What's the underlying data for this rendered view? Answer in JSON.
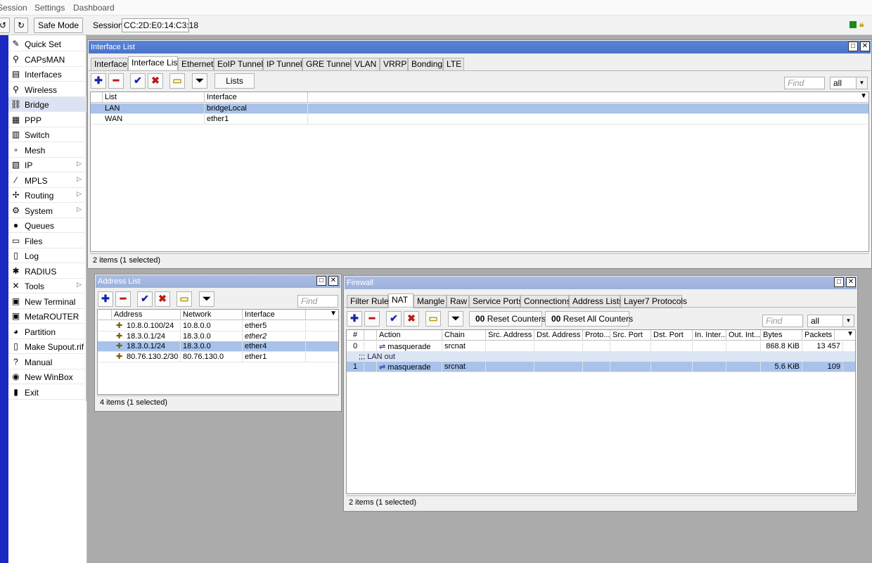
{
  "menu": {
    "session": "Session",
    "settings": "Settings",
    "dashboard": "Dashboard"
  },
  "toolbar": {
    "undo": "↺",
    "redo": "↻",
    "safe_mode": "Safe Mode",
    "session_label": "Session:",
    "session_value": "CC:2D:E0:14:C3:18"
  },
  "sidebar": {
    "items": [
      {
        "label": "Quick Set",
        "icon": "✎"
      },
      {
        "label": "CAPsMAN",
        "icon": "⚲"
      },
      {
        "label": "Interfaces",
        "icon": "▤"
      },
      {
        "label": "Wireless",
        "icon": "⚲"
      },
      {
        "label": "Bridge",
        "icon": "⛓"
      },
      {
        "label": "PPP",
        "icon": "▦"
      },
      {
        "label": "Switch",
        "icon": "▥"
      },
      {
        "label": "Mesh",
        "icon": "∘"
      },
      {
        "label": "IP",
        "icon": "▧",
        "arrow": "▷"
      },
      {
        "label": "MPLS",
        "icon": "⁄",
        "arrow": "▷"
      },
      {
        "label": "Routing",
        "icon": "✢",
        "arrow": "▷"
      },
      {
        "label": "System",
        "icon": "⚙",
        "arrow": "▷"
      },
      {
        "label": "Queues",
        "icon": "●"
      },
      {
        "label": "Files",
        "icon": "▭"
      },
      {
        "label": "Log",
        "icon": "▯"
      },
      {
        "label": "RADIUS",
        "icon": "✱"
      },
      {
        "label": "Tools",
        "icon": "✕",
        "arrow": "▷"
      },
      {
        "label": "New Terminal",
        "icon": "▣"
      },
      {
        "label": "MetaROUTER",
        "icon": "▣"
      },
      {
        "label": "Partition",
        "icon": "◕"
      },
      {
        "label": "Make Supout.rif",
        "icon": "▯"
      },
      {
        "label": "Manual",
        "icon": "?"
      },
      {
        "label": "New WinBox",
        "icon": "◉"
      },
      {
        "label": "Exit",
        "icon": "▮"
      }
    ]
  },
  "interface_list": {
    "title": "Interface List",
    "tabs": [
      "Interface",
      "Interface List",
      "Ethernet",
      "EoIP Tunnel",
      "IP Tunnel",
      "GRE Tunnel",
      "VLAN",
      "VRRP",
      "Bonding",
      "LTE"
    ],
    "lists_button": "Lists",
    "find_placeholder": "Find",
    "filter_value": "all",
    "columns": [
      "List",
      "Interface"
    ],
    "rows": [
      {
        "list": "LAN",
        "interface": "bridgeLocal"
      },
      {
        "list": "WAN",
        "interface": "ether1"
      }
    ],
    "status": "2 items (1 selected)"
  },
  "address_list": {
    "title": "Address List",
    "find_placeholder": "Find",
    "columns": [
      "Address",
      "Network",
      "Interface"
    ],
    "rows": [
      {
        "address": "10.8.0.100/24",
        "network": "10.8.0.0",
        "interface": "ether5"
      },
      {
        "address": "18.3.0.1/24",
        "network": "18.3.0.0",
        "interface": "ether2"
      },
      {
        "address": "18.3.0.1/24",
        "network": "18.3.0.0",
        "interface": "ether4"
      },
      {
        "address": "80.76.130.2/30",
        "network": "80.76.130.0",
        "interface": "ether1"
      }
    ],
    "status": "4 items (1 selected)"
  },
  "firewall": {
    "title": "Firewall",
    "tabs": [
      "Filter Rules",
      "NAT",
      "Mangle",
      "Raw",
      "Service Ports",
      "Connections",
      "Address Lists",
      "Layer7 Protocols"
    ],
    "reset_counters": "Reset Counters",
    "reset_all_counters": "Reset All Counters",
    "counter_icon": "00",
    "find_placeholder": "Find",
    "filter_value": "all",
    "columns": [
      "#",
      "Action",
      "Chain",
      "Src. Address",
      "Dst. Address",
      "Proto...",
      "Src. Port",
      "Dst. Port",
      "In. Inter...",
      "Out. Int...",
      "Bytes",
      "Packets"
    ],
    "rows": [
      {
        "num": "0",
        "action": "masquerade",
        "chain": "srcnat",
        "bytes": "868.8 KiB",
        "packets": "13 457"
      },
      {
        "comment": ";;; LAN out"
      },
      {
        "num": "1",
        "action": "masquerade",
        "chain": "srcnat",
        "bytes": "5.6 KiB",
        "packets": "109"
      }
    ],
    "status": "2 items (1 selected)"
  },
  "icons": {
    "add": "✚",
    "remove": "━",
    "enable": "✔",
    "disable": "✖",
    "comment": "▭",
    "filter": "⏷",
    "maximize": "□",
    "close": "✕",
    "dropdown": "▼",
    "masq": "⇌"
  }
}
